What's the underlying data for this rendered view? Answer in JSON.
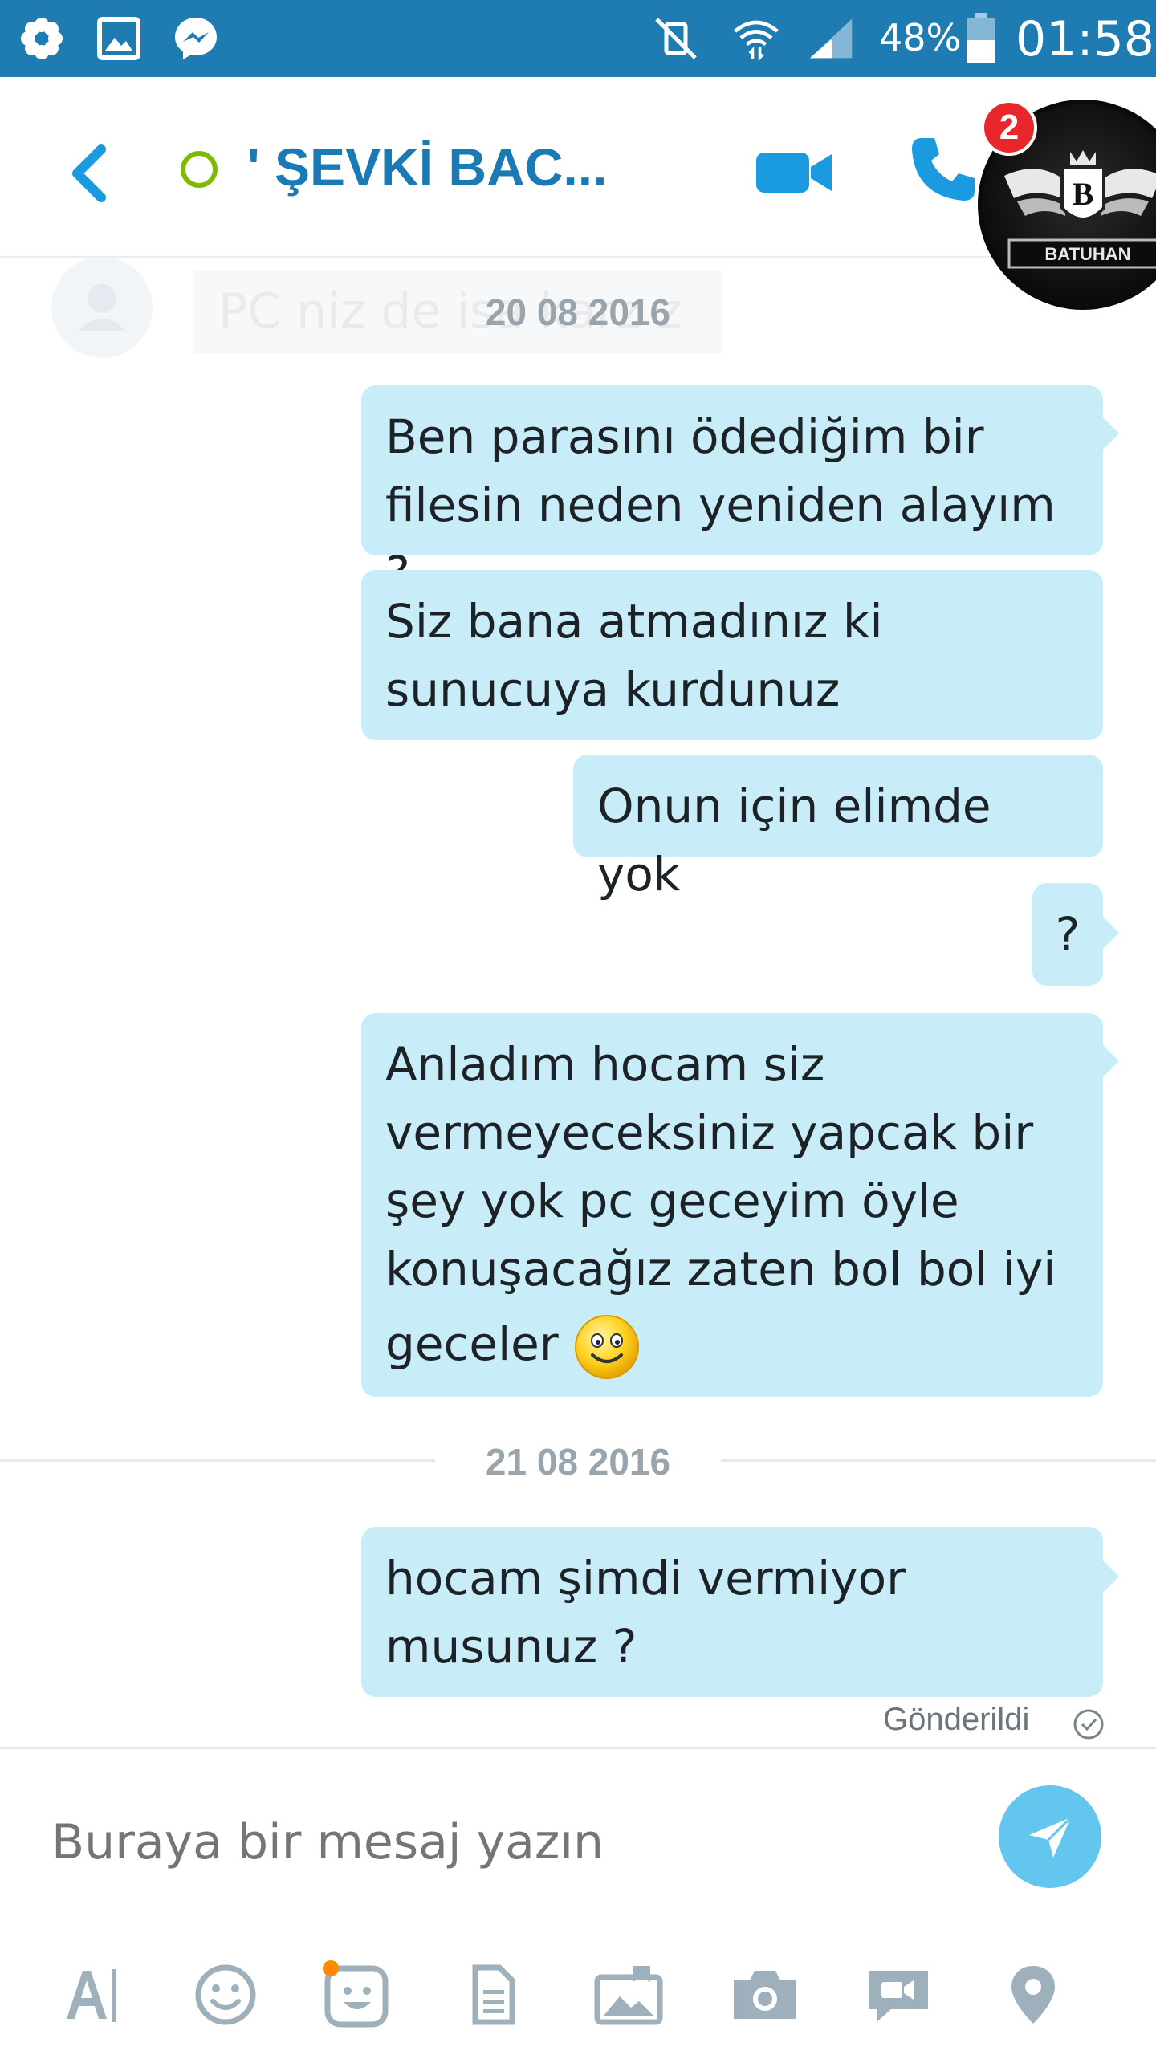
{
  "status_bar": {
    "battery": "48%",
    "time": "01:58",
    "icons": [
      "flower-icon",
      "gallery-icon",
      "messenger-icon",
      "vibrate-off-icon",
      "wifi-icon",
      "signal-icon",
      "battery-icon"
    ]
  },
  "header": {
    "contact_name": "' ŞEVKİ BAC...",
    "presence": "offline",
    "chat_head_badge": "2",
    "chat_head_label": "BATUHAN",
    "chat_head_letter": "B"
  },
  "conversation": {
    "ghost_preview": "PC niz de isa  karz z",
    "date_1": "20 08 2016",
    "date_2": "21 08 2016",
    "messages": [
      {
        "line1": "Ben parasını ödediğim bir",
        "line2": "filesin neden yeniden alayım ?"
      },
      {
        "line1": "Siz bana atmadınız ki",
        "line2": "sunucuya kurdunuz"
      },
      {
        "line1": "Onun için elimde yok"
      },
      {
        "line1": "?"
      },
      {
        "line1": "Anladım hocam siz",
        "line2": "vermeyeceksiniz yapcak bir",
        "line3": "şey yok pc geceyim öyle",
        "line4": "konuşacağız zaten bol bol iyi",
        "line5": "geceler"
      },
      {
        "line1": "hocam şimdi vermiyor",
        "line2": "musunuz ?"
      }
    ],
    "sent_status": "Gönderildi"
  },
  "composer": {
    "placeholder": "Buraya bir mesaj yazın"
  },
  "colors": {
    "status_bar": "#1f7cb3",
    "accent": "#1a7ab5",
    "bubble": "#c8ecf8",
    "send_button": "#62c6ef",
    "presence": "#7fba00",
    "badge": "#e9262c"
  },
  "toolbar_icons": [
    "text-format-icon",
    "emoticon-icon",
    "moji-icon",
    "file-icon",
    "photo-album-icon",
    "camera-icon",
    "video-message-icon",
    "location-icon"
  ]
}
